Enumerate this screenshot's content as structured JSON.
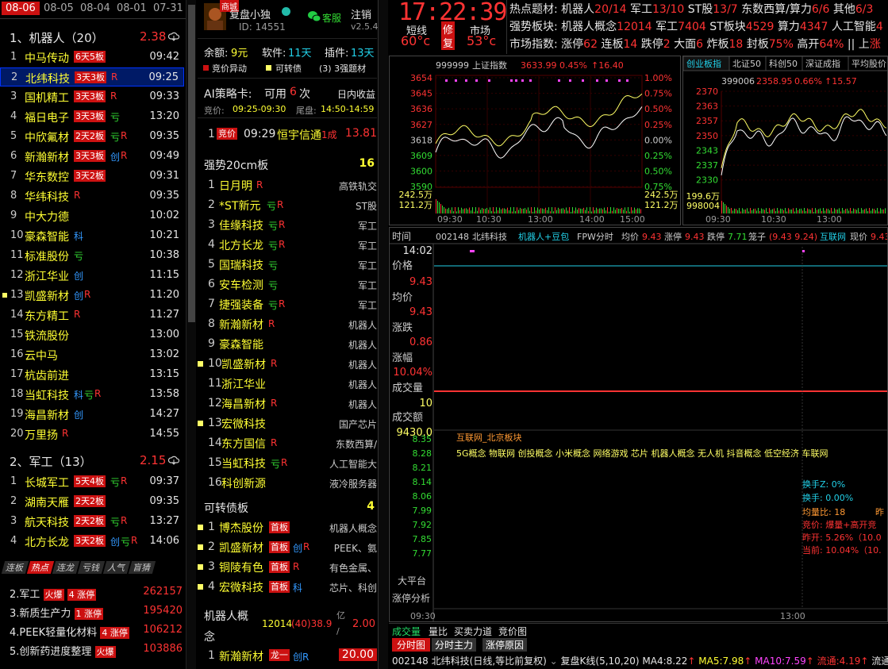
{
  "dates": [
    "08-06",
    "08-05",
    "08-04",
    "08-01",
    "07-31"
  ],
  "groups": [
    {
      "title": "1、机器人（20）",
      "value": "2.38",
      "rows": [
        {
          "n": "1",
          "name": "中马传动",
          "tag": "6天5板",
          "extra": "",
          "time": "09:42"
        },
        {
          "n": "2",
          "name": "北纬科技",
          "tag": "3天3板",
          "extra": "R",
          "time": "09:25"
        },
        {
          "n": "3",
          "name": "国机精工",
          "tag": "3天3板",
          "extra": "R",
          "time": "09:33"
        },
        {
          "n": "4",
          "name": "福日电子",
          "tag": "3天3板",
          "extra": "亏",
          "time": "13:20"
        },
        {
          "n": "5",
          "name": "中欣氟材",
          "tag": "2天2板",
          "extra": "亏R",
          "time": "09:35"
        },
        {
          "n": "6",
          "name": "新瀚新材",
          "tag": "3天3板",
          "extra": "创R",
          "time": "09:49"
        },
        {
          "n": "7",
          "name": "华东数控",
          "tag": "3天2板",
          "extra": "",
          "time": "09:31"
        },
        {
          "n": "8",
          "name": "华纬科技",
          "tag": "",
          "extra": "R",
          "time": "09:35"
        },
        {
          "n": "9",
          "name": "中大力德",
          "tag": "",
          "extra": "",
          "time": "10:02"
        },
        {
          "n": "10",
          "name": "豪森智能",
          "tag": "",
          "extra": "科",
          "time": "10:21"
        },
        {
          "n": "11",
          "name": "标准股份",
          "tag": "",
          "extra": "亏",
          "time": "10:38"
        },
        {
          "n": "12",
          "name": "浙江华业",
          "tag": "",
          "extra": "创",
          "time": "11:15"
        },
        {
          "n": "13",
          "name": "凯盛新材",
          "tag": "",
          "extra": "创R",
          "time": "11:20"
        },
        {
          "n": "14",
          "name": "东方精工",
          "tag": "",
          "extra": "R",
          "time": "11:27"
        },
        {
          "n": "15",
          "name": "铁流股份",
          "tag": "",
          "extra": "",
          "time": "13:00"
        },
        {
          "n": "16",
          "name": "云中马",
          "tag": "",
          "extra": "",
          "time": "13:02"
        },
        {
          "n": "17",
          "name": "杭齿前进",
          "tag": "",
          "extra": "",
          "time": "13:15"
        },
        {
          "n": "18",
          "name": "当虹科技",
          "tag": "",
          "extra": "科亏R",
          "time": "13:58"
        },
        {
          "n": "19",
          "name": "海昌新材",
          "tag": "",
          "extra": "创",
          "time": "14:27"
        },
        {
          "n": "20",
          "name": "万里扬",
          "tag": "",
          "extra": "R",
          "time": "14:55"
        }
      ]
    },
    {
      "title": "2、军工（13）",
      "value": "2.15",
      "rows": [
        {
          "n": "1",
          "name": "长城军工",
          "tag": "5天4板",
          "extra": "亏R",
          "time": "09:37"
        },
        {
          "n": "2",
          "name": "湖南天雁",
          "tag": "2天2板",
          "extra": "",
          "time": "09:35"
        },
        {
          "n": "3",
          "name": "航天科技",
          "tag": "2天2板",
          "extra": "亏R",
          "time": "13:27"
        },
        {
          "n": "4",
          "name": "北方长龙",
          "tag": "3天2板",
          "extra": "创亏R",
          "time": "14:06"
        }
      ]
    }
  ],
  "left_tabs": [
    "连板",
    "热点",
    "连龙",
    "亏钱",
    "人气",
    "盲猜"
  ],
  "hot": [
    {
      "name": "2.军工",
      "tag1": "火爆",
      "tag2": "4 涨停",
      "value": "262157"
    },
    {
      "name": "3.新质生产力",
      "tag1": "",
      "tag2": "1 涨停",
      "value": "195420"
    },
    {
      "name": "4.PEEK轻量化材料",
      "tag1": "",
      "tag2": "4 涨停",
      "value": "106212"
    },
    {
      "name": "5.创新药进度整理",
      "tag1": "火爆",
      "tag2": "",
      "value": "103886"
    }
  ],
  "user": {
    "badge": "商城",
    "name": "复盘小独",
    "id": "ID: 14551",
    "service": "客服",
    "logout": "注销",
    "version": "v2.5.4"
  },
  "balance": {
    "label1": "余额:",
    "v1": "9元",
    "label2": "软件:",
    "v2": "11天",
    "label3": "插件:",
    "v3": "13天"
  },
  "legend": [
    "竞价异动",
    "可转债",
    "(3) 3强题材"
  ],
  "ai": {
    "title": "AI策略卡:",
    "avail": "可用",
    "count": "6",
    "unit": "次",
    "right": "日内收益",
    "l1": "竞价:",
    "t1": "09:25-09:30",
    "l2": "尾盘:",
    "t2": "14:50-14:59"
  },
  "ai_row": {
    "n": "1",
    "tag": "竞价",
    "time": "09:29",
    "name": "恒宇信通",
    "mark": "1成",
    "value": "13.81"
  },
  "strong": {
    "title": "强势20cm板",
    "count": "16",
    "rows": [
      {
        "n": "1",
        "name": "日月明",
        "ex": "R",
        "cat": "高铁轨交"
      },
      {
        "n": "2",
        "name": "*ST新元",
        "ex": "亏R",
        "cat": "ST股"
      },
      {
        "n": "3",
        "name": "佳缘科技",
        "ex": "亏R",
        "cat": "军工"
      },
      {
        "n": "4",
        "name": "北方长龙",
        "ex": "亏R",
        "cat": "军工"
      },
      {
        "n": "5",
        "name": "国瑞科技",
        "ex": "亏",
        "cat": "军工"
      },
      {
        "n": "6",
        "name": "安车检测",
        "ex": "亏",
        "cat": "军工"
      },
      {
        "n": "7",
        "name": "捷强装备",
        "ex": "亏R",
        "cat": "军工"
      },
      {
        "n": "8",
        "name": "新瀚新材",
        "ex": "R",
        "cat": "机器人"
      },
      {
        "n": "9",
        "name": "豪森智能",
        "ex": "",
        "cat": "机器人"
      },
      {
        "n": "10",
        "name": "凯盛新材",
        "ex": "R",
        "cat": "机器人"
      },
      {
        "n": "11",
        "name": "浙江华业",
        "ex": "",
        "cat": "机器人"
      },
      {
        "n": "12",
        "name": "海昌新材",
        "ex": "R",
        "cat": "机器人"
      },
      {
        "n": "13",
        "name": "宏微科技",
        "ex": "",
        "cat": "国产芯片"
      },
      {
        "n": "14",
        "name": "东方国信",
        "ex": "R",
        "cat": "东数西算/"
      },
      {
        "n": "15",
        "name": "当虹科技",
        "ex": "亏R",
        "cat": "人工智能大"
      },
      {
        "n": "16",
        "name": "科创新源",
        "ex": "",
        "cat": "液冷服务器"
      }
    ]
  },
  "cb": {
    "title": "可转债板",
    "count": "4",
    "rows": [
      {
        "n": "1",
        "name": "博杰股份",
        "tag": "首板",
        "ex": "",
        "cat": "机器人概念"
      },
      {
        "n": "2",
        "name": "凯盛新材",
        "tag": "首板",
        "ex": "创R",
        "cat": "PEEK、氨"
      },
      {
        "n": "3",
        "name": "铜陵有色",
        "tag": "首板",
        "ex": "R",
        "cat": "有色金属、"
      },
      {
        "n": "4",
        "name": "宏微科技",
        "tag": "首板",
        "ex": "科",
        "cat": "芯片、科创"
      }
    ]
  },
  "concept": {
    "title": "机器人概念",
    "v1": "12014",
    "v2": "(40)38.9",
    "unit": "亿 /",
    "v3": "2.00"
  },
  "concept_row": {
    "n": "1",
    "name": "新瀚新材",
    "tag": "龙一",
    "ex": "创R",
    "value": "20.00"
  },
  "clock": {
    "time": "17:22:39",
    "l1": "短线",
    "v1": "60°c",
    "m1": "修",
    "m2": "复",
    "l2": "市场",
    "v2": "53°c"
  },
  "hotlines": [
    {
      "label": "热点题材:",
      "items": [
        [
          "机器人",
          "20/14"
        ],
        [
          "军工",
          "13/10"
        ],
        [
          "ST股",
          "13/7"
        ],
        [
          "东数西算/算力",
          "6/6"
        ],
        [
          "其他",
          "6/3"
        ]
      ]
    },
    {
      "label": "强势板块:",
      "items": [
        [
          "机器人概念",
          "12014"
        ],
        [
          "军工",
          "7404"
        ],
        [
          "ST板块",
          "4529"
        ],
        [
          "算力",
          "4347"
        ],
        [
          "人工智能",
          "4"
        ]
      ]
    },
    {
      "label": "市场指数:",
      "items": [
        [
          "涨停",
          "62"
        ],
        [
          "连板",
          "14"
        ],
        [
          "跌停",
          "2"
        ],
        [
          "大面",
          "6"
        ],
        [
          "炸板",
          "18"
        ],
        [
          "封板",
          "75%"
        ],
        [
          "高开",
          "64%"
        ],
        [
          "|| 上",
          "涨"
        ]
      ]
    }
  ],
  "idx1": {
    "code": "999999",
    "name": "上证指数",
    "price": "3633.99",
    "pct": "0.45%",
    "chg": "16.40",
    "yl": [
      "3654",
      "3645",
      "3636",
      "3627",
      "3618",
      "3609",
      "3600",
      "3590"
    ],
    "yr": [
      "1.00%",
      "0.75%",
      "0.50%",
      "0.25%",
      "0.00%",
      "0.25%",
      "0.50%",
      "0.75%"
    ],
    "vol1": "242.5万",
    "vol2": "121.2万",
    "xt": [
      "09:30",
      "10:30",
      "13:00",
      "14:00",
      "15:00"
    ]
  },
  "idx2": {
    "tabs": [
      "创业板指",
      "北证50",
      "科创50",
      "深证成指",
      "平均股价"
    ],
    "code": "399006",
    "price": "2358.95",
    "pct": "0.66%",
    "chg": "15.57",
    "yl": [
      "2370",
      "2363",
      "2357",
      "2350",
      "2343",
      "2337",
      "2330"
    ],
    "vol1": "199.6万",
    "vol2": "998004",
    "xt": [
      "09:30",
      "10:30",
      "13:00"
    ]
  },
  "stock": {
    "title": "时间",
    "code": "002148",
    "name": "北纬科技",
    "concept": "机器人+豆包",
    "fpw": "FPW分时",
    "avg_l": "均价",
    "avg": "9.43",
    "up_l": "涨停",
    "up": "9.43",
    "dn_l": "跌停",
    "dn": "7.71",
    "cage_l": "笼子",
    "cage": "(9.43 9.24)",
    "net": "互联网",
    "now_l": "现价",
    "now": "9.43"
  },
  "quote": {
    "time": "14:02",
    "price_l": "价格",
    "price": "9.43",
    "avg_l": "均价",
    "avg": "9.43",
    "chg_l": "涨跌",
    "chg": "0.86",
    "pct_l": "涨幅",
    "pct": "10.04%",
    "vol_l": "成交量",
    "vol": "10",
    "amt_l": "成交额",
    "amt": "9430.0",
    "b1": "大平台",
    "b2": "涨停分析"
  },
  "plates": {
    "line1": "互联网_北京板块",
    "line2": "5G概念 物联网 创投概念 小米概念 网络游戏 芯片 机器人概念 无人机 抖音概念 低空经济 车联网"
  },
  "ylevels": [
    "8.35",
    "8.28",
    "8.21",
    "8.14",
    "8.06",
    "7.99",
    "7.92",
    "7.85",
    "7.77"
  ],
  "info": [
    [
      "换手Z:",
      "0%"
    ],
    [
      "换手:",
      "0.00%"
    ],
    [
      "均量比:",
      "18"
    ],
    [
      "竞价:",
      "爆量+高开竞"
    ],
    [
      "昨开:",
      "5.26%（10.0"
    ],
    [
      "当前:",
      "10.04%（10."
    ]
  ],
  "info_extra": "昨",
  "bot_xt": [
    "09:30",
    "13:00"
  ],
  "bot_tabs": [
    "成交量",
    "量比",
    "买卖力道",
    "竞价图"
  ],
  "bot_tabs2": [
    "分时图",
    "分时主力",
    "涨停原因"
  ],
  "status": {
    "code": "002148",
    "name": "北纬科技(日线,等比前复权)",
    "k": "复盘K线(5,10,20)",
    "ma4_l": "MA4:",
    "ma4": "8.22",
    "ma5_l": "MA5:",
    "ma5": "7.98",
    "ma10_l": "MA10:",
    "ma10": "7.59",
    "flow_l": "流通:",
    "flow": "4.19",
    "flow2_l": "流通",
    "flow2": ""
  },
  "chart_data": [
    {
      "type": "line",
      "title": "上证指数",
      "x": [
        "09:30",
        "10:30",
        "13:00",
        "14:00",
        "15:00"
      ],
      "series": [
        {
          "name": "上证指数",
          "values": [
            3617,
            3622,
            3628,
            3634,
            3634
          ]
        }
      ],
      "ylim": [
        3590,
        3654
      ]
    },
    {
      "type": "line",
      "title": "",
      "x": [
        "09:30",
        "10:30",
        "13:00"
      ],
      "series": [
        {
          "name": "",
          "values": [
            2335,
            2355,
            2358
          ]
        }
      ],
      "ylim": [
        2330,
        2370
      ]
    }
  ]
}
